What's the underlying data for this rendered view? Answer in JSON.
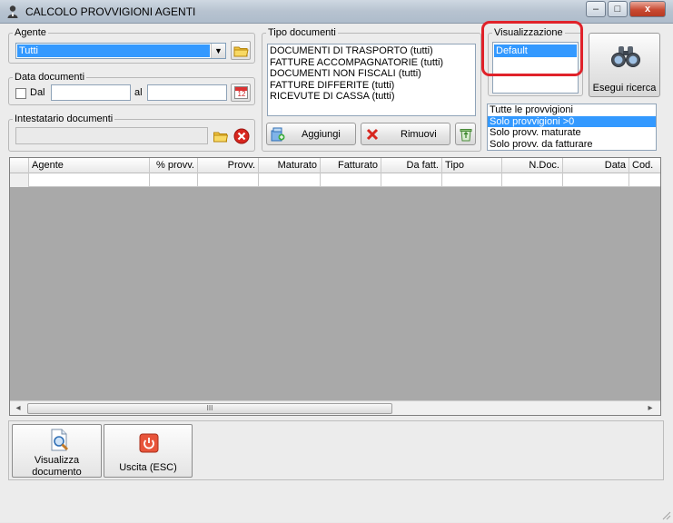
{
  "window": {
    "title": "CALCOLO PROVVIGIONI AGENTI",
    "minimize": "–",
    "maximize": "□",
    "close": "x"
  },
  "agente": {
    "legend": "Agente",
    "selected": "Tutti"
  },
  "data_documenti": {
    "legend": "Data documenti",
    "dal_label": "Dal",
    "al_label": "al",
    "dal_value": "",
    "al_value": "",
    "calendar_label": "12"
  },
  "intestatario": {
    "legend": "Intestatario documenti",
    "value": ""
  },
  "tipo_documenti": {
    "legend": "Tipo documenti",
    "items": [
      "DOCUMENTI DI TRASPORTO (tutti)",
      "FATTURE ACCOMPAGNATORIE (tutti)",
      "DOCUMENTI NON FISCALI (tutti)",
      "FATTURE DIFFERITE (tutti)",
      "RICEVUTE DI CASSA (tutti)"
    ],
    "add_label": "Aggiungi",
    "remove_label": "Rimuovi"
  },
  "visualizzazione": {
    "legend": "Visualizzazione",
    "items": [
      "Default"
    ],
    "selected_index": 0
  },
  "search_button": {
    "label": "Esegui ricerca"
  },
  "filter_list": {
    "items": [
      "Tutte le provvigioni",
      "Solo provvigioni >0",
      "Solo provv. maturate",
      "Solo provv. da fatturare"
    ],
    "selected_index": 1
  },
  "grid": {
    "columns": [
      "Agente",
      "% provv.",
      "Provv.",
      "Maturato",
      "Fatturato",
      "Da fatt.",
      "Tipo",
      "N.Doc.",
      "Data",
      "Cod."
    ],
    "rows": [
      [
        "",
        "",
        "",
        "",
        "",
        "",
        "",
        "",
        "",
        ""
      ]
    ],
    "scroll_left": "◂",
    "scroll_right": "▸",
    "thumb_grip": "III"
  },
  "bottom": {
    "view_doc_label_1": "Visualizza",
    "view_doc_label_2": "documento",
    "exit_label": "Uscita (ESC)"
  },
  "colors": {
    "selection": "#3399ff",
    "highlight_ring": "#e0222a",
    "grid_background": "#a9a9a9"
  }
}
